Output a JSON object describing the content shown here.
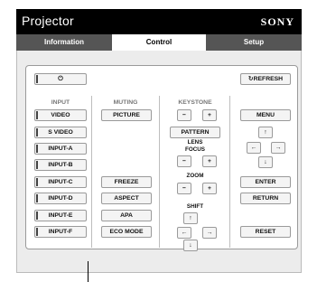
{
  "app": {
    "title": "Projector",
    "brand": "SONY"
  },
  "tabs": [
    {
      "label": "Information",
      "active": false
    },
    {
      "label": "Control",
      "active": true
    },
    {
      "label": "Setup",
      "active": false
    }
  ],
  "power": {
    "icon": "power-icon",
    "glyph": "⏻"
  },
  "refresh": {
    "icon": "refresh-icon",
    "glyph": "↻",
    "label": "REFRESH"
  },
  "sections": {
    "input": "INPUT",
    "muting": "MUTING",
    "keystone": "KEYSTONE",
    "lens": "LENS",
    "focus": "FOCUS",
    "zoom": "ZOOM",
    "shift": "SHIFT"
  },
  "input_buttons": [
    "VIDEO",
    "S VIDEO",
    "INPUT-A",
    "INPUT-B",
    "INPUT-C",
    "INPUT-D",
    "INPUT-E",
    "INPUT-F"
  ],
  "muting_buttons": [
    "PICTURE"
  ],
  "picture_buttons": [
    "FREEZE",
    "ASPECT",
    "APA",
    "ECO MODE"
  ],
  "keystone": {
    "minus": "−",
    "plus": "+",
    "pattern": "PATTERN"
  },
  "focus": {
    "minus": "−",
    "plus": "+"
  },
  "zoom": {
    "minus": "−",
    "plus": "+"
  },
  "arrows": {
    "up": "↑",
    "down": "↓",
    "left": "←",
    "right": "→"
  },
  "menu": {
    "menu": "MENU",
    "enter": "ENTER",
    "return": "RETURN",
    "reset": "RESET"
  }
}
